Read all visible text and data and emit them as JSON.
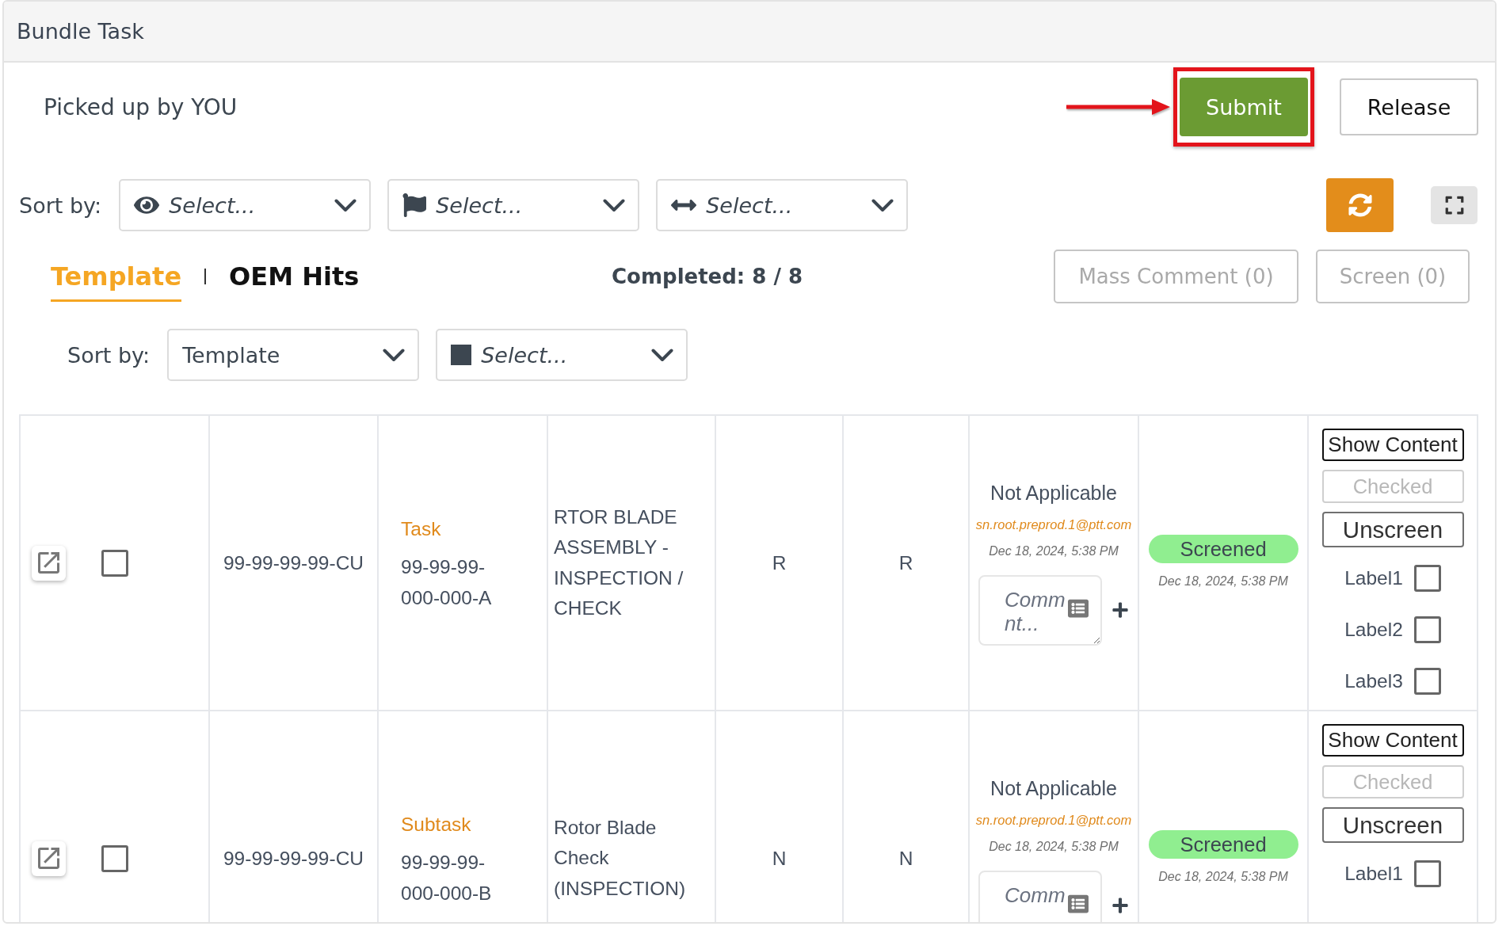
{
  "window": {
    "title": "Bundle Task"
  },
  "pickup": {
    "text": "Picked up by YOU"
  },
  "actions": [
    {
      "label": "Submit",
      "kind": "primary",
      "highlighted": true
    },
    {
      "label": "Release",
      "kind": "secondary",
      "highlighted": false
    }
  ],
  "filters": {
    "label": "Sort by:",
    "selects": [
      {
        "placeholder": "Select..."
      },
      {
        "placeholder": "Select..."
      },
      {
        "placeholder": "Select..."
      }
    ]
  },
  "tabs": [
    {
      "label": "Template",
      "selected": true
    },
    {
      "label": "OEM Hits",
      "selected": false
    }
  ],
  "completed": "Completed: 8 / 8",
  "bulk_actions": [
    {
      "label": "Mass Comment (0)",
      "disabled": true
    },
    {
      "label": "Screen (0)",
      "disabled": true
    }
  ],
  "sort": {
    "label": "Sort by:",
    "selects": [
      {
        "value": "Template"
      },
      {
        "placeholder": "Select..."
      }
    ]
  },
  "table": {
    "rows": [
      {
        "checked": false,
        "column_2": "99-99-99-99-CU",
        "column_3": {
          "tag": "Task",
          "text": "99-99-99-000-000-A"
        },
        "column_4": "RTOR BLADE ASSEMBLY - INSPECTION / CHECK",
        "column_5": "R",
        "column_6": "R",
        "comment": {
          "status": "Not Applicable",
          "user": "sn.root.preprod.1@ptt.com",
          "time": "Dec 18, 2024, 5:38 PM",
          "placeholder": "Comm nt..."
        },
        "screening": {
          "status": "Screened",
          "time": "Dec 18, 2024, 5:38 PM"
        },
        "buttons": [
          {
            "label": "Show Content",
            "kind": "dark",
            "disabled": false
          },
          {
            "label": "Checked",
            "kind": "plain",
            "disabled": true
          },
          {
            "label": "Unscreen",
            "kind": "large",
            "disabled": false
          }
        ],
        "labels": [
          {
            "text": "Label1",
            "checked": false
          },
          {
            "text": "Label2",
            "checked": false
          },
          {
            "text": "Label3",
            "checked": false
          }
        ]
      },
      {
        "checked": false,
        "column_2": "99-99-99-99-CU",
        "column_3": {
          "tag": "Subtask",
          "text": "99-99-99-000-000-B"
        },
        "column_4": "Rotor Blade Check (INSPECTION)",
        "column_5": "N",
        "column_6": "N",
        "comment": {
          "status": "Not Applicable",
          "user": "sn.root.preprod.1@ptt.com",
          "time": "Dec 18, 2024, 5:38 PM",
          "placeholder": "Comm"
        },
        "screening": {
          "status": "Screened",
          "time": "Dec 18, 2024, 5:38 PM"
        },
        "buttons": [
          {
            "label": "Show Content",
            "kind": "dark",
            "disabled": false
          },
          {
            "label": "Checked",
            "kind": "plain",
            "disabled": true
          },
          {
            "label": "Unscreen",
            "kind": "large",
            "disabled": false
          }
        ],
        "labels": [
          {
            "text": "Label1",
            "checked": false
          }
        ]
      }
    ]
  }
}
